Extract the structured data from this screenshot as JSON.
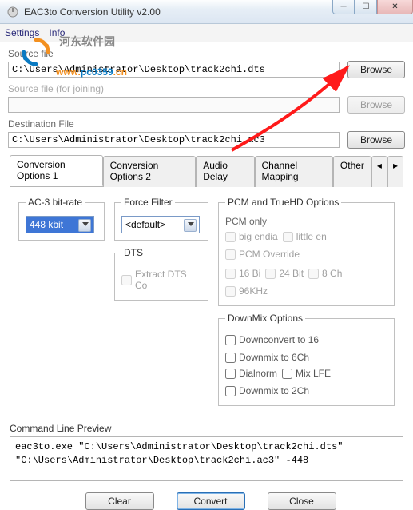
{
  "window": {
    "title": "EAC3to Conversion Utility  v2.00"
  },
  "menu": {
    "settings": "Settings",
    "info": "Info"
  },
  "watermark": {
    "text1": "www.",
    "text2": "pc0359",
    "text3": ".cn",
    "cn": "河东软件园"
  },
  "source": {
    "label": "Source file",
    "value": "C:\\Users\\Administrator\\Desktop\\track2chi.dts",
    "browse": "Browse"
  },
  "source2": {
    "label": "Source file (for joining)",
    "value": "",
    "browse": "Browse"
  },
  "dest": {
    "label": "Destination File",
    "value": "C:\\Users\\Administrator\\Desktop\\track2chi.ac3",
    "browse": "Browse"
  },
  "tabs": {
    "t1": "Conversion Options 1",
    "t2": "Conversion Options 2",
    "t3": "Audio Delay",
    "t4": "Channel Mapping",
    "t5": "Other"
  },
  "options": {
    "bitrate_legend": "AC-3 bit-rate",
    "bitrate_value": "448 kbit",
    "force_legend": "Force Filter",
    "force_value": "<default>",
    "dts_legend": "DTS",
    "dts_extract": "Extract DTS Co",
    "pcm_legend": "PCM and TrueHD Options",
    "pcm_only": "PCM only",
    "big_endian": "big endia",
    "little_en": "little en",
    "pcm_override": "PCM Override",
    "b16": "16 Bi",
    "b24": "24 Bit",
    "ch8": "8 Ch",
    "khz96": "96KHz",
    "downmix_legend": "DownMix Options",
    "downconv16": "Downconvert to 16",
    "down6": "Downmix to 6Ch",
    "dialnorm": "Dialnorm",
    "mixlfe": "Mix LFE",
    "down2": "Downmix to 2Ch"
  },
  "cmd": {
    "legend": "Command Line Preview",
    "text": "eac3to.exe \"C:\\Users\\Administrator\\Desktop\\track2chi.dts\" \"C:\\Users\\Administrator\\Desktop\\track2chi.ac3\" -448"
  },
  "footer": {
    "clear": "Clear",
    "convert": "Convert",
    "close": "Close"
  }
}
